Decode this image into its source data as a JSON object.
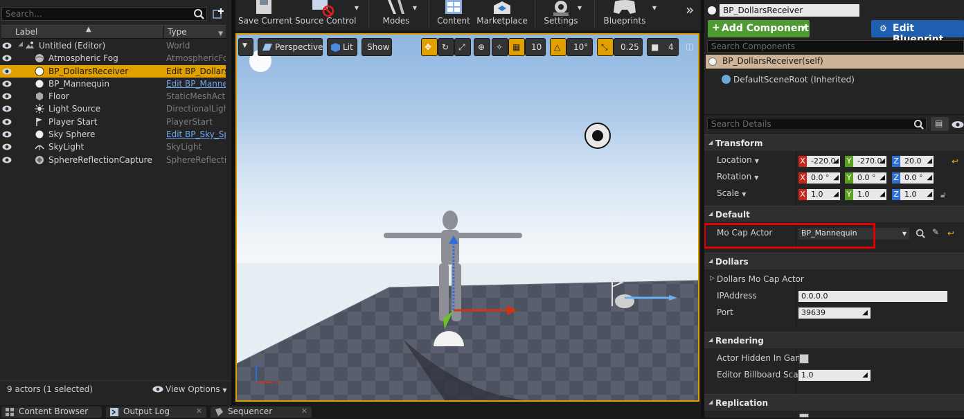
{
  "outliner": {
    "search_placeholder": "Search...",
    "col_label": "Label",
    "col_type": "Type",
    "rows": [
      {
        "label": "Untitled (Editor)",
        "type": "World",
        "icon": "world-icon"
      },
      {
        "label": "Atmospheric Fog",
        "type": "AtmosphericFog",
        "icon": "fog-icon"
      },
      {
        "label": "BP_DollarsReceiver",
        "type": "Edit BP_Dollars",
        "icon": "sphere-icon"
      },
      {
        "label": "BP_Mannequin",
        "type": "Edit BP_Manne",
        "icon": "sphere-icon"
      },
      {
        "label": "Floor",
        "type": "StaticMeshActor",
        "icon": "mesh-icon"
      },
      {
        "label": "Light Source",
        "type": "DirectionalLight",
        "icon": "sun-icon"
      },
      {
        "label": "Player Start",
        "type": "PlayerStart",
        "icon": "flag-icon"
      },
      {
        "label": "Sky Sphere",
        "type": "Edit BP_Sky_Sp",
        "icon": "sphere-icon"
      },
      {
        "label": "SkyLight",
        "type": "SkyLight",
        "icon": "skylight-icon"
      },
      {
        "label": "SphereReflectionCapture",
        "type": "SphereReflection",
        "icon": "reflection-icon"
      }
    ],
    "status": "9 actors (1 selected)",
    "view_options": "View Options"
  },
  "bottom_tabs": [
    "Content Browser",
    "Output Log",
    "Sequencer"
  ],
  "toolbar": {
    "save_current": "Save Current",
    "source_control": "Source Control",
    "modes": "Modes",
    "content": "Content",
    "marketplace": "Marketplace",
    "settings": "Settings",
    "blueprints": "Blueprints"
  },
  "viewport": {
    "perspective": "Perspective",
    "lit": "Lit",
    "show": "Show",
    "grid_snap": "10",
    "rot_snap": "10°",
    "scale_snap": "0.25",
    "cam_speed": "4",
    "accent": "#e2a000"
  },
  "details": {
    "actor_name": "BP_DollarsReceiver",
    "add_component": "Add Component",
    "edit_blueprint": "Edit Blueprint",
    "search_components": "Search Components",
    "component_self": "BP_DollarsReceiver(self)",
    "component_root": "DefaultSceneRoot (Inherited)",
    "search_details": "Search Details",
    "transform": {
      "title": "Transform",
      "location_label": "Location",
      "rotation_label": "Rotation",
      "scale_label": "Scale",
      "location": [
        "-220.0",
        "-270.0",
        "20.0"
      ],
      "rotation": [
        "0.0 °",
        "0.0 °",
        "0.0 °"
      ],
      "scale": [
        "1.0",
        "1.0",
        "1.0"
      ]
    },
    "default": {
      "title": "Default",
      "mocap_label": "Mo Cap Actor",
      "mocap_value": "BP_Mannequin"
    },
    "dollars": {
      "title": "Dollars",
      "sub_label": "Dollars Mo Cap Actor",
      "ip_label": "IPAddress",
      "ip_value": "0.0.0.0",
      "port_label": "Port",
      "port_value": "39639"
    },
    "rendering": {
      "title": "Rendering",
      "hidden_label": "Actor Hidden In Game",
      "billboard_label": "Editor Billboard Scale",
      "billboard_value": "1.0"
    },
    "replication": {
      "title": "Replication"
    }
  }
}
